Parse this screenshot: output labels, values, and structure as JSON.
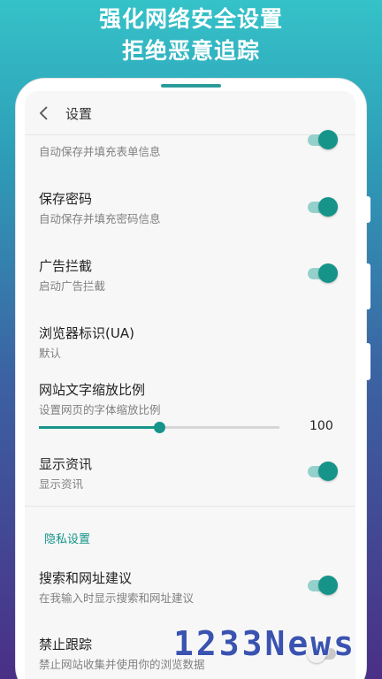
{
  "promo": {
    "line1": "强化网络安全设置",
    "line2": "拒绝恶意追踪"
  },
  "header": {
    "title": "设置",
    "back_icon": "chevron-left-icon"
  },
  "rows": [
    {
      "title": "",
      "subtitle": "自动保存并填充表单信息",
      "toggle": true
    },
    {
      "title": "保存密码",
      "subtitle": "自动保存并填充密码信息",
      "toggle": true
    },
    {
      "title": "广告拦截",
      "subtitle": "启动广告拦截",
      "toggle": true
    },
    {
      "title": "浏览器标识(UA)",
      "subtitle": "默认"
    },
    {
      "title": "网站文字缩放比例",
      "subtitle": "设置网页的字体缩放比例"
    },
    {
      "title": "显示资讯",
      "subtitle": "显示资讯",
      "toggle": true
    },
    {
      "title": "搜索和网址建议",
      "subtitle": "在我输入时显示搜索和网址建议",
      "toggle": true
    },
    {
      "title": "禁止跟踪",
      "subtitle": "禁止网站收集并使用你的浏览数据",
      "toggle": false
    }
  ],
  "text_scale": {
    "value": "100",
    "fraction": 0.5
  },
  "privacy_section": {
    "title": "隐私设置"
  },
  "watermark": "1233News",
  "colors": {
    "accent": "#16948a",
    "accent_light": "#95d1cc",
    "bg_top": "#35c2c8",
    "bg_bottom": "#4a2f86"
  }
}
